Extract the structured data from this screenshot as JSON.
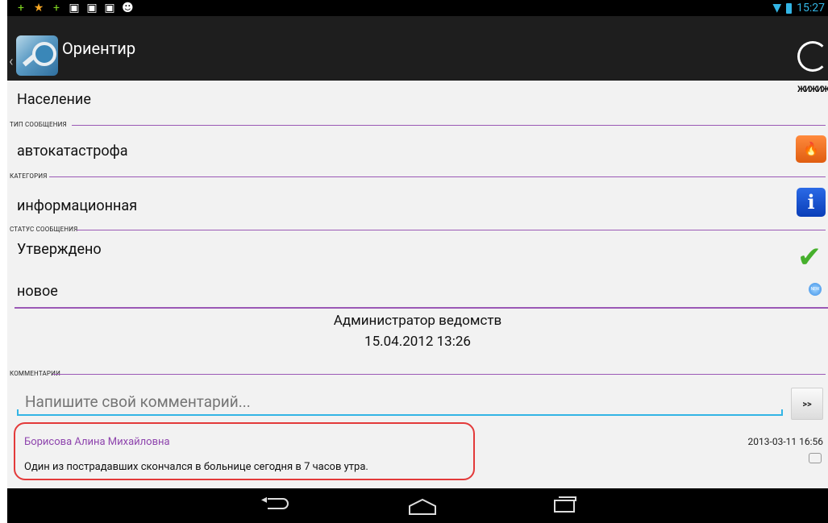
{
  "status_bar": {
    "notification_icons": [
      "plus-icon",
      "star-icon",
      "plus-icon",
      "image-icon",
      "download-icon",
      "download-icon",
      "android-icon"
    ],
    "time": "15:27"
  },
  "action_bar": {
    "title": "Ориентир"
  },
  "fields": {
    "population_value": "Население",
    "message_type_label": "ТИП СООБЩЕНИЯ",
    "message_type_value": "автокатастрофа",
    "category_label": "КАТЕГОРИЯ",
    "category_value": "информационная",
    "status_label": "СТАТУС СООБЩЕНИЯ",
    "status_value": "Утверждено",
    "state_value": "новое"
  },
  "author_block": {
    "author": "Администратор ведомств",
    "datetime": "15.04.2012 13:26"
  },
  "comments": {
    "section_label": "КОММЕНТАРИИ",
    "input_placeholder": "Напишите свой комментарий...",
    "send_label": ">>",
    "items": [
      {
        "author": "Борисова Алина Михайловна",
        "date": "2013-03-11 16:56",
        "text": "Один из пострадавших скончался в больнице сегодня в 7 часов утра."
      }
    ]
  },
  "icons": {
    "new_badge_text": "NEW"
  },
  "colors": {
    "accent_purple": "#9b59b6",
    "input_blue": "#33b5e5",
    "highlight_red": "#e33a3a"
  }
}
